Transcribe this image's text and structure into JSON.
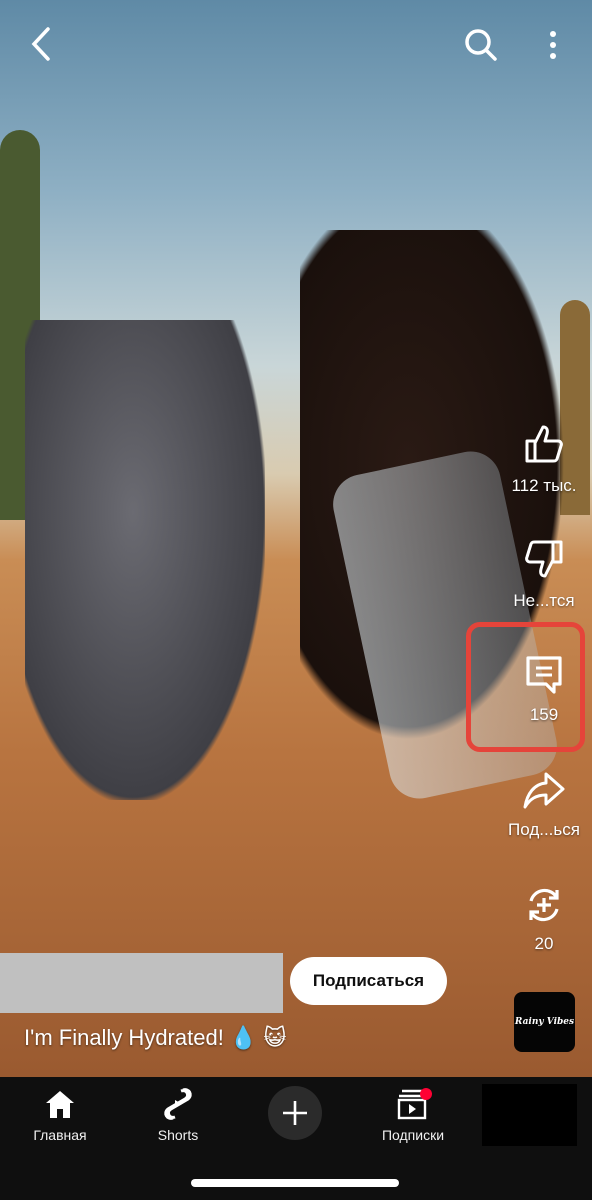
{
  "top_bar": {
    "back_icon": "chevron-left",
    "search_icon": "search",
    "more_icon": "more-vertical"
  },
  "actions": {
    "like": {
      "icon": "thumb-up",
      "label": "112 тыс."
    },
    "dislike": {
      "icon": "thumb-down",
      "label": "Не...тся"
    },
    "comments": {
      "icon": "comment",
      "label": "159"
    },
    "share": {
      "icon": "share",
      "label": "Под...ься"
    },
    "remix": {
      "icon": "remix",
      "label": "20"
    },
    "highlight_color": "#e5443a"
  },
  "channel": {
    "subscribe_label": "Подписаться"
  },
  "video": {
    "title": "I'm Finally Hydrated! 💧 😺"
  },
  "audio": {
    "thumbnail_text": "Rainy Vibes"
  },
  "nav": {
    "items": [
      {
        "label": "Главная",
        "icon": "home"
      },
      {
        "label": "Shorts",
        "icon": "shorts"
      },
      {
        "label": "",
        "icon": "plus"
      },
      {
        "label": "Подписки",
        "icon": "subscriptions"
      }
    ],
    "notification_color": "#ff0033"
  }
}
